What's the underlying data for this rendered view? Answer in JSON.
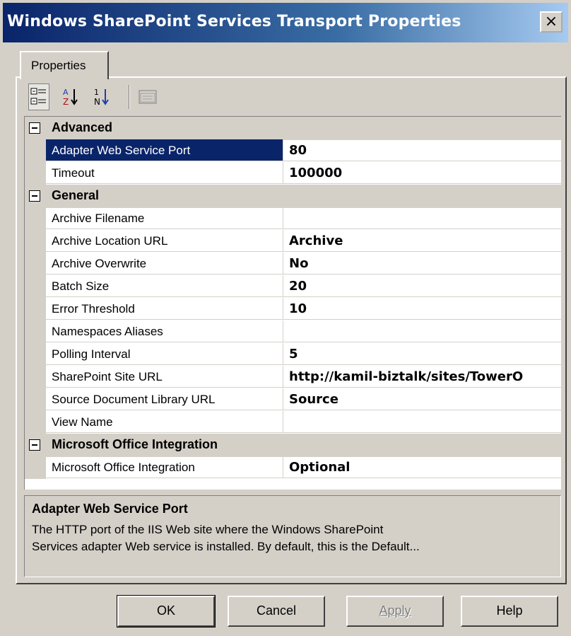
{
  "window": {
    "title": "Windows SharePoint Services Transport Properties",
    "close_label": "×"
  },
  "tabs": [
    {
      "label": "Properties"
    }
  ],
  "toolbar": {
    "categorized_icon": "categorized-icon",
    "alpha_icon": "sort-alpha-icon",
    "numeric_icon": "sort-numeric-icon",
    "pages_icon": "property-pages-icon"
  },
  "categories": [
    {
      "name": "Advanced",
      "collapse_glyph": "−",
      "props": [
        {
          "name": "Adapter Web Service Port",
          "value": "80",
          "selected": true
        },
        {
          "name": "Timeout",
          "value": "100000"
        }
      ]
    },
    {
      "name": "General",
      "collapse_glyph": "−",
      "props": [
        {
          "name": "Archive Filename",
          "value": ""
        },
        {
          "name": "Archive Location URL",
          "value": "Archive"
        },
        {
          "name": "Archive Overwrite",
          "value": "No"
        },
        {
          "name": "Batch Size",
          "value": "20"
        },
        {
          "name": "Error Threshold",
          "value": "10"
        },
        {
          "name": "Namespaces Aliases",
          "value": ""
        },
        {
          "name": "Polling Interval",
          "value": "5"
        },
        {
          "name": "SharePoint Site URL",
          "value": "http://kamil-biztalk/sites/TowerO"
        },
        {
          "name": "Source Document Library URL",
          "value": "Source"
        },
        {
          "name": "View Name",
          "value": ""
        }
      ]
    },
    {
      "name": "Microsoft Office Integration",
      "collapse_glyph": "−",
      "props": [
        {
          "name": "Microsoft Office Integration",
          "value": "Optional"
        }
      ]
    }
  ],
  "description": {
    "title": "Adapter Web Service Port",
    "line1": "The HTTP port of the IIS Web site where the Windows SharePoint",
    "line2": "Services adapter Web service is installed. By default, this is the Default..."
  },
  "buttons": {
    "ok": "OK",
    "cancel": "Cancel",
    "apply": "Apply",
    "help": "Help"
  }
}
